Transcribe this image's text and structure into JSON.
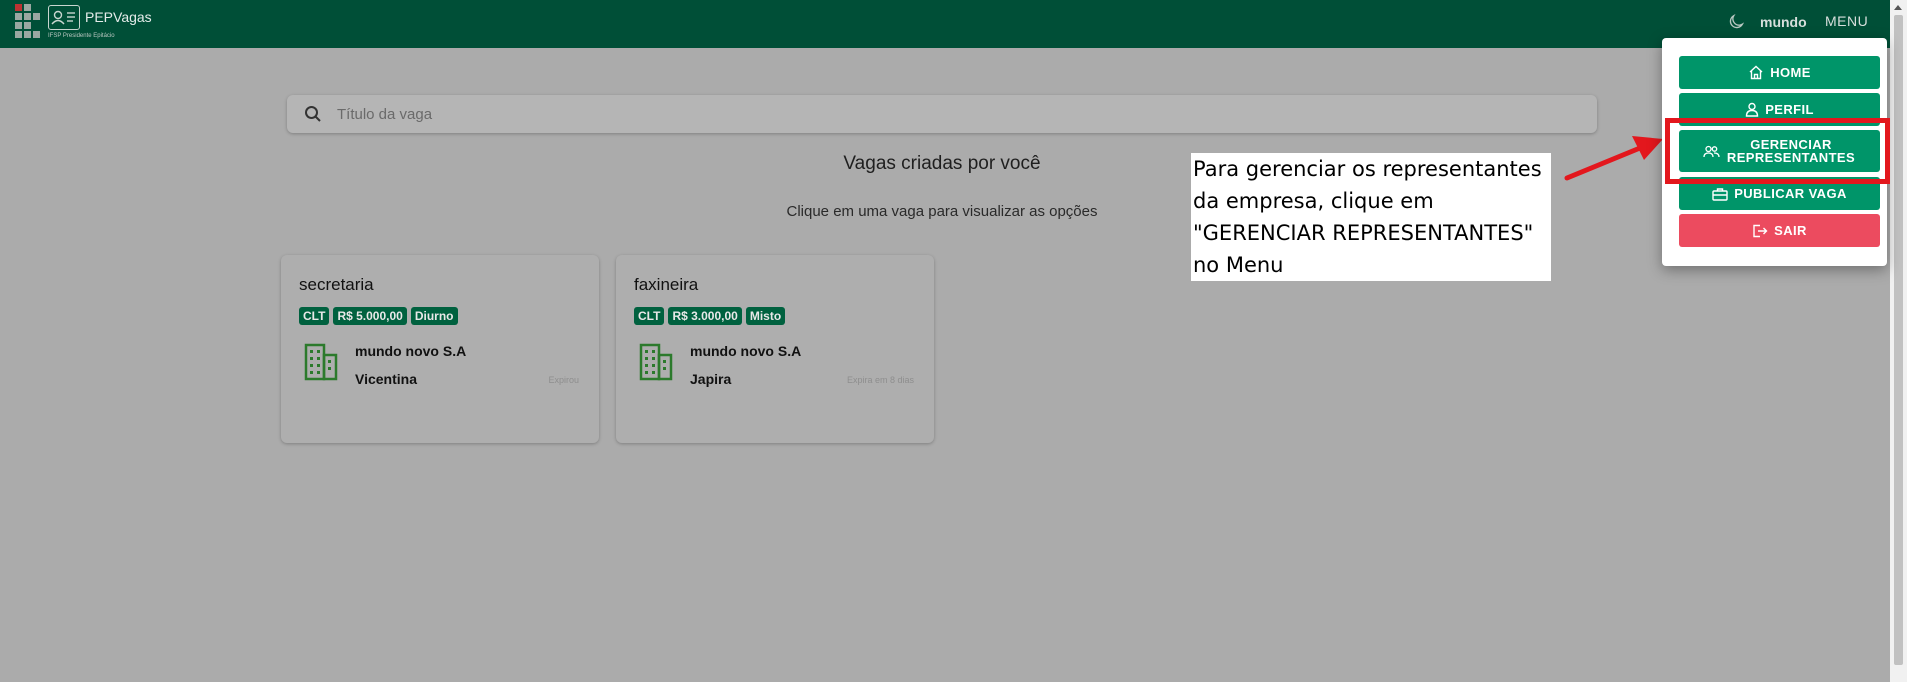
{
  "header": {
    "brand": "PEPVagas",
    "brand_sub": "IFSP Presidente Epitácio",
    "user": "mundo",
    "menu_label": "MENU",
    "colors": {
      "bar": "#004f37",
      "accent": "#009569",
      "danger": "#ec4b5f"
    }
  },
  "search": {
    "placeholder": "Título da vaga",
    "value": "",
    "icon": "search-icon"
  },
  "main": {
    "title": "Vagas criadas por você",
    "subtitle": "Clique em uma vaga para visualizar as opções"
  },
  "jobs": [
    {
      "title": "secretaria",
      "tags": [
        "CLT",
        "R$ 5.000,00",
        "Diurno"
      ],
      "company": "mundo novo S.A",
      "city": "Vicentina",
      "expiry": "Expirou",
      "icon": "building-icon"
    },
    {
      "title": "faxineira",
      "tags": [
        "CLT",
        "R$ 3.000,00",
        "Misto"
      ],
      "company": "mundo novo S.A",
      "city": "Japira",
      "expiry": "Expira em 8 dias",
      "icon": "building-icon"
    }
  ],
  "menu": {
    "items": [
      {
        "label": "HOME",
        "icon": "home-icon"
      },
      {
        "label": "PERFIL",
        "icon": "user-icon"
      },
      {
        "label": "GERENCIAR REPRESENTANTES",
        "icon": "users-icon"
      },
      {
        "label": "PUBLICAR VAGA",
        "icon": "briefcase-icon"
      },
      {
        "label": "SAIR",
        "icon": "logout-icon"
      }
    ]
  },
  "annotation": {
    "lines": [
      "Para gerenciar os representantes",
      "da empresa, clique em",
      "\"GERENCIAR REPRESENTANTES\"",
      "no Menu"
    ],
    "color": "#e3171d"
  }
}
